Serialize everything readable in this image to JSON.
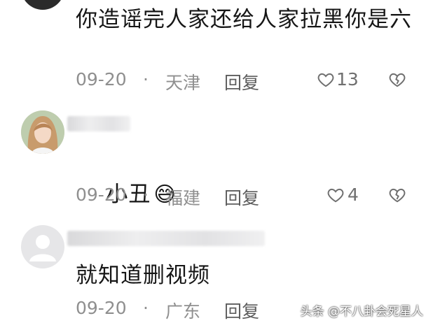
{
  "comments": [
    {
      "text": "你造谣完人家还给人家拉黑你是六",
      "date": "09-20",
      "location": "天津",
      "reply_label": "回复",
      "likes": "13"
    },
    {
      "text": "小丑",
      "emoji": "😅",
      "date": "09-20",
      "location": "福建",
      "reply_label": "回复",
      "likes": "4"
    },
    {
      "text": "就知道删视频",
      "date": "09-20",
      "location": "广东",
      "reply_label": "回复"
    }
  ],
  "separator": "·",
  "watermark": "头条 @不八卦会死星人",
  "icons": {
    "like": "heart-outline-icon",
    "dislike": "broken-heart-icon",
    "avatar_default": "default-user-avatar-icon"
  },
  "colors": {
    "text": "#161616",
    "meta": "#8f8f8f",
    "icon": "#6f6f6f"
  }
}
